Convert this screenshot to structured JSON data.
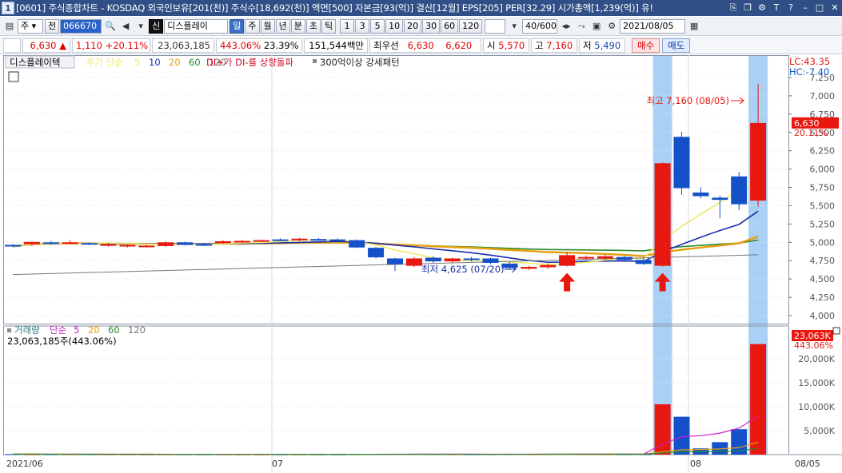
{
  "window": {
    "number": "1",
    "title": "[0601] 주식종합차트 - KOSDAQ 외국인보유[201(천)] 주식수[18,692(천)] 액면[500] 자본금[93(억)] 결산[12월] EPS[205] PER[32.29] 시가총액[1,239(억)] 유!"
  },
  "toolbar": {
    "market": "주",
    "prev_label": "전",
    "code": "066670",
    "new_label": "신",
    "name": "디스플레이",
    "periods": [
      "일",
      "주",
      "월",
      "년",
      "분",
      "초",
      "틱"
    ],
    "active_period": "일",
    "intervals": [
      "1",
      "3",
      "5",
      "10",
      "20",
      "30",
      "60",
      "120"
    ],
    "count": "40",
    "count_total": "/600",
    "date": "2021/08/05"
  },
  "info": {
    "price": "6,630",
    "arrow": "▲",
    "change": "1,110",
    "change_pct": "+20.11%",
    "volume": "23,063,185",
    "vol_ratio": "443.06%",
    "turnover": "23.39%",
    "amount": "151,544백만",
    "bid_label": "최우선",
    "bid1": "6,630",
    "bid2": "6,620",
    "open_label": "시",
    "open": "5,570",
    "high_label": "고",
    "high": "7,160",
    "low_label": "저",
    "low": "5,490",
    "buy_label": "매수",
    "sell_label": "매도"
  },
  "legend": {
    "stock_label": "디스플레이텍",
    "ma_label": "주가 단순",
    "ma_periods": [
      "5",
      "10",
      "20",
      "60",
      "120"
    ],
    "signal": "DI+가 DI-를 상향돌파",
    "pattern": "300억이상 강세패턴",
    "lc": "LC:43.35",
    "hc": "HC:-7.40"
  },
  "volume_legend": {
    "label": "거래량",
    "ma_label": "단순",
    "periods": [
      "5",
      "20",
      "60",
      "120"
    ],
    "value": "23,063,185주(443.06%)",
    "badge_value": "23,063K",
    "badge_pct": "443.06%"
  },
  "annotations": {
    "high": "최고 7,160 (08/05)",
    "low": "최저 4,625 (07/20)"
  },
  "price_badge": {
    "price": "6,630",
    "pct": "20.11%"
  },
  "colors": {
    "up": "#e8170f",
    "down": "#1451c9",
    "highlight": "#a9d0f5",
    "ma5": "#f0e86a",
    "ma10": "#1a2faa",
    "ma20": "#e6a011",
    "ma60": "#2b8a2b",
    "ma120": "#777777"
  },
  "chart_data": {
    "type": "candlestick",
    "price_axis": [
      "7,250",
      "7,000",
      "6,750",
      "6,500",
      "6,250",
      "6,000",
      "5,750",
      "5,500",
      "5,250",
      "5,000",
      "4,750",
      "4,500",
      "4,250",
      "4,000"
    ],
    "volume_axis": [
      "20,000K",
      "15,000K",
      "10,000K",
      "5,000K"
    ],
    "x_labels": [
      "2021/06",
      "07",
      "08",
      "08/05"
    ],
    "ylim": [
      3900,
      7400
    ],
    "candles": [
      {
        "o": 4965,
        "h": 4980,
        "l": 4935,
        "c": 4945
      },
      {
        "o": 4975,
        "h": 5010,
        "l": 4950,
        "c": 5005
      },
      {
        "o": 5000,
        "h": 5020,
        "l": 4980,
        "c": 4995
      },
      {
        "o": 4995,
        "h": 5030,
        "l": 4990,
        "c": 5000
      },
      {
        "o": 4990,
        "h": 5000,
        "l": 4960,
        "c": 4975
      },
      {
        "o": 4960,
        "h": 4990,
        "l": 4940,
        "c": 4975
      },
      {
        "o": 4950,
        "h": 4975,
        "l": 4930,
        "c": 4965
      },
      {
        "o": 4950,
        "h": 4970,
        "l": 4930,
        "c": 4955
      },
      {
        "o": 4950,
        "h": 5015,
        "l": 4940,
        "c": 5000
      },
      {
        "o": 5000,
        "h": 5010,
        "l": 4960,
        "c": 4965
      },
      {
        "o": 4975,
        "h": 4990,
        "l": 4950,
        "c": 4960
      },
      {
        "o": 4990,
        "h": 5030,
        "l": 4980,
        "c": 5015
      },
      {
        "o": 5010,
        "h": 5030,
        "l": 4995,
        "c": 5020
      },
      {
        "o": 5020,
        "h": 5040,
        "l": 5005,
        "c": 5030
      },
      {
        "o": 5040,
        "h": 5055,
        "l": 5020,
        "c": 5030
      },
      {
        "o": 5030,
        "h": 5060,
        "l": 5015,
        "c": 5050
      },
      {
        "o": 5045,
        "h": 5060,
        "l": 5020,
        "c": 5030
      },
      {
        "o": 5040,
        "h": 5055,
        "l": 5010,
        "c": 5020
      },
      {
        "o": 5030,
        "h": 5040,
        "l": 4920,
        "c": 4930
      },
      {
        "o": 4925,
        "h": 4940,
        "l": 4780,
        "c": 4795
      },
      {
        "o": 4780,
        "h": 4790,
        "l": 4610,
        "c": 4700
      },
      {
        "o": 4680,
        "h": 4800,
        "l": 4660,
        "c": 4780
      },
      {
        "o": 4790,
        "h": 4810,
        "l": 4720,
        "c": 4740
      },
      {
        "o": 4740,
        "h": 4790,
        "l": 4720,
        "c": 4780
      },
      {
        "o": 4780,
        "h": 4800,
        "l": 4740,
        "c": 4760
      },
      {
        "o": 4780,
        "h": 4790,
        "l": 4700,
        "c": 4720
      },
      {
        "o": 4710,
        "h": 4730,
        "l": 4625,
        "c": 4650
      },
      {
        "o": 4640,
        "h": 4680,
        "l": 4625,
        "c": 4665
      },
      {
        "o": 4660,
        "h": 4710,
        "l": 4640,
        "c": 4690
      },
      {
        "o": 4680,
        "h": 4870,
        "l": 4670,
        "c": 4825
      },
      {
        "o": 4790,
        "h": 4820,
        "l": 4760,
        "c": 4800
      },
      {
        "o": 4780,
        "h": 4830,
        "l": 4760,
        "c": 4810
      },
      {
        "o": 4800,
        "h": 4820,
        "l": 4740,
        "c": 4760
      },
      {
        "o": 4760,
        "h": 4790,
        "l": 4690,
        "c": 4705
      },
      {
        "o": 4680,
        "h": 6090,
        "l": 4670,
        "c": 6080
      },
      {
        "o": 6440,
        "h": 6510,
        "l": 5650,
        "c": 5740
      },
      {
        "o": 5680,
        "h": 5750,
        "l": 5600,
        "c": 5630
      },
      {
        "o": 5610,
        "h": 5640,
        "l": 5330,
        "c": 5580
      },
      {
        "o": 5900,
        "h": 5960,
        "l": 5440,
        "c": 5520
      },
      {
        "o": 5570,
        "h": 7160,
        "l": 5490,
        "c": 6630
      }
    ],
    "volumes": [
      110,
      90,
      80,
      75,
      70,
      70,
      65,
      60,
      70,
      65,
      60,
      60,
      60,
      55,
      55,
      55,
      50,
      50,
      80,
      120,
      140,
      110,
      90,
      80,
      70,
      80,
      90,
      85,
      110,
      150,
      100,
      80,
      70,
      90,
      10500,
      7900,
      1300,
      2600,
      5300,
      23063
    ],
    "highlight_indices": [
      34,
      39
    ],
    "signal_arrow_indices": [
      29,
      34
    ]
  }
}
